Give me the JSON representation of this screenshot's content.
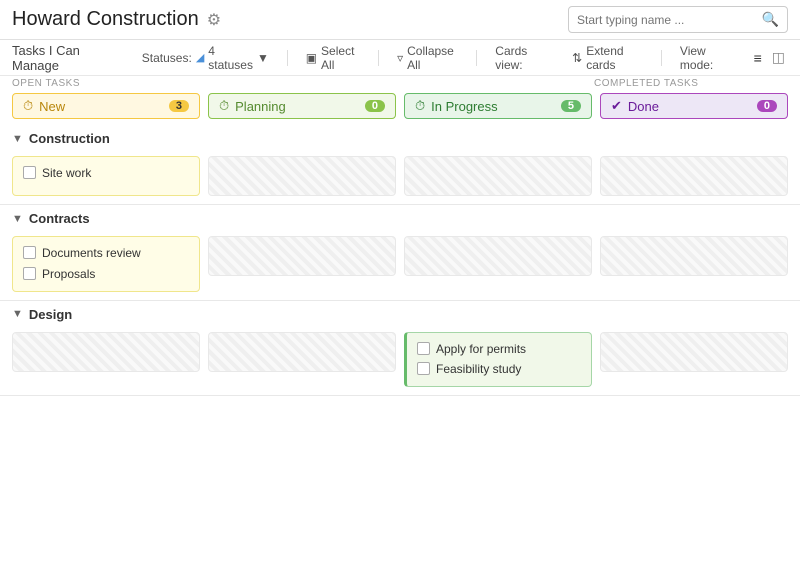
{
  "header": {
    "title": "Howard Construction",
    "search_placeholder": "Start typing name ...",
    "gear_label": "settings"
  },
  "toolbar": {
    "left_label": "Tasks I Can Manage",
    "statuses_label": "Statuses:",
    "statuses_filter": "4 statuses",
    "select_all": "Select All",
    "collapse_all": "Collapse All",
    "cards_view": "Cards view:",
    "extend_cards": "Extend cards",
    "view_mode": "View mode:"
  },
  "sections": {
    "open_tasks": "OPEN TASKS",
    "completed_tasks": "COMPLETED TASKS"
  },
  "statuses": [
    {
      "id": "new",
      "label": "New",
      "count": "3",
      "icon": "⏱"
    },
    {
      "id": "planning",
      "label": "Planning",
      "count": "0",
      "icon": "⏱"
    },
    {
      "id": "inprogress",
      "label": "In Progress",
      "count": "5",
      "icon": "⏱"
    },
    {
      "id": "done",
      "label": "Done",
      "count": "0",
      "icon": "✔"
    }
  ],
  "groups": [
    {
      "name": "Construction",
      "columns": [
        {
          "type": "new",
          "items": [
            {
              "text": "Site work",
              "checked": false
            }
          ]
        },
        {
          "type": "planning",
          "items": []
        },
        {
          "type": "inprogress",
          "items": []
        },
        {
          "type": "done",
          "items": []
        }
      ]
    },
    {
      "name": "Contracts",
      "columns": [
        {
          "type": "new",
          "items": [
            {
              "text": "Documents review",
              "checked": false
            },
            {
              "text": "Proposals",
              "checked": false
            }
          ]
        },
        {
          "type": "planning",
          "items": []
        },
        {
          "type": "inprogress",
          "items": []
        },
        {
          "type": "done",
          "items": []
        }
      ]
    },
    {
      "name": "Design",
      "columns": [
        {
          "type": "new",
          "items": []
        },
        {
          "type": "planning",
          "items": []
        },
        {
          "type": "inprogress",
          "items": [
            {
              "text": "Apply for permits",
              "checked": false
            },
            {
              "text": "Feasibility study",
              "checked": false
            }
          ]
        },
        {
          "type": "done",
          "items": []
        }
      ]
    }
  ]
}
